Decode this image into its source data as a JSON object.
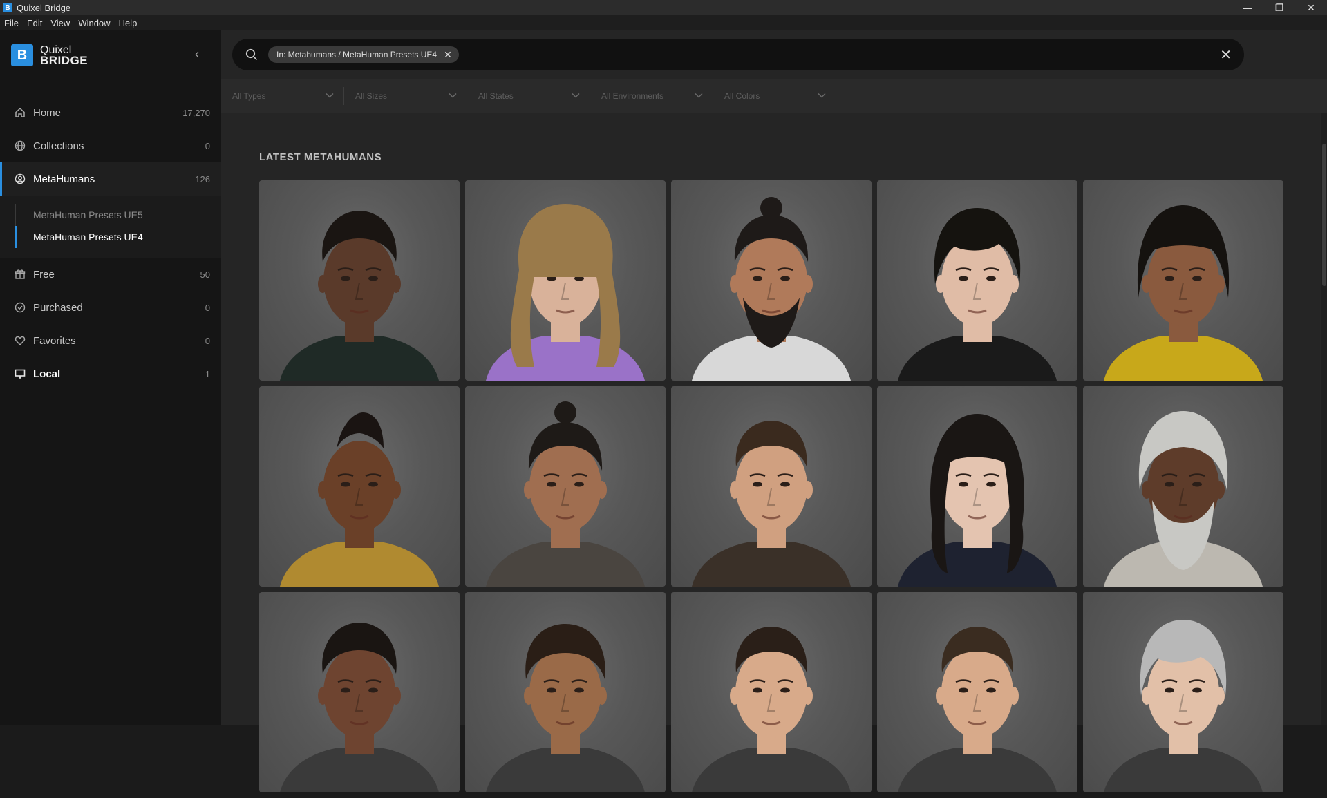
{
  "window": {
    "title": "Quixel Bridge",
    "icon_letter": "B",
    "minimize": "—",
    "restore": "❐",
    "close": "✕"
  },
  "menu": [
    "File",
    "Edit",
    "View",
    "Window",
    "Help"
  ],
  "logo": {
    "letter": "B",
    "line1": "Quixel",
    "line2": "BRIDGE"
  },
  "sidebar": {
    "collapse_glyph": "‹",
    "items": [
      {
        "label": "Home",
        "count": "17,270",
        "icon": "home-icon"
      },
      {
        "label": "Collections",
        "count": "0",
        "icon": "globe-icon"
      },
      {
        "label": "MetaHumans",
        "count": "126",
        "icon": "user-circle-icon"
      },
      {
        "label": "Free",
        "count": "50",
        "icon": "gift-icon"
      },
      {
        "label": "Purchased",
        "count": "0",
        "icon": "check-circle-icon"
      },
      {
        "label": "Favorites",
        "count": "0",
        "icon": "heart-icon"
      },
      {
        "label": "Local",
        "count": "1",
        "icon": "monitor-icon"
      }
    ],
    "sub_items": [
      {
        "label": "MetaHuman Presets UE5"
      },
      {
        "label": "MetaHuman Presets UE4"
      }
    ]
  },
  "search": {
    "chip": "In: Metahumans / MetaHuman Presets UE4",
    "chip_remove": "✕",
    "clear": "✕"
  },
  "filters": [
    "All Types",
    "All Sizes",
    "All States",
    "All Environments",
    "All Colors"
  ],
  "section_title": "LATEST METAHUMANS",
  "metahumans": [
    {
      "skin": "#5a3a2a",
      "hair": "#1a1512",
      "clothing": "#1f2a26",
      "hair_style": "short-curly"
    },
    {
      "skin": "#d9b29a",
      "hair": "#9a7a4a",
      "clothing": "#9a72c8",
      "hair_style": "long-wavy"
    },
    {
      "skin": "#b07a5a",
      "hair": "#1e1a18",
      "clothing": "#d8d8d8",
      "hair_style": "bun-beard"
    },
    {
      "skin": "#e0bca6",
      "hair": "#15130f",
      "clothing": "#1a1a1a",
      "hair_style": "bob"
    },
    {
      "skin": "#8a5a3e",
      "hair": "#15120f",
      "clothing": "#c8a81a",
      "hair_style": "medium"
    },
    {
      "skin": "#6a4028",
      "hair": "#1a1412",
      "clothing": "#b08a30",
      "hair_style": "mohawk"
    },
    {
      "skin": "#a06e50",
      "hair": "#1e1a17",
      "clothing": "#4a4540",
      "hair_style": "bun"
    },
    {
      "skin": "#d0a080",
      "hair": "#3a2a1e",
      "clothing": "#3a3028",
      "hair_style": "short"
    },
    {
      "skin": "#e4c4b0",
      "hair": "#1a1614",
      "clothing": "#1e2230",
      "hair_style": "long-dark"
    },
    {
      "skin": "#5e3c2a",
      "hair": "#c8c8c4",
      "clothing": "#bcb8b0",
      "hair_style": "white-long-beard"
    },
    {
      "skin": "#6e4430",
      "hair": "#1a1512",
      "clothing": "#3a3a3a",
      "hair_style": "short-curly"
    },
    {
      "skin": "#9a6a48",
      "hair": "#2a1e16",
      "clothing": "#3a3a3a",
      "hair_style": "curly"
    },
    {
      "skin": "#d8aa8a",
      "hair": "#2a1f18",
      "clothing": "#3a3a3a",
      "hair_style": "short"
    },
    {
      "skin": "#d8aa8a",
      "hair": "#3a2c20",
      "clothing": "#3a3a3a",
      "hair_style": "short"
    },
    {
      "skin": "#e2c0a8",
      "hair": "#b8b8b8",
      "clothing": "#3a3a3a",
      "hair_style": "grey-bob"
    }
  ]
}
